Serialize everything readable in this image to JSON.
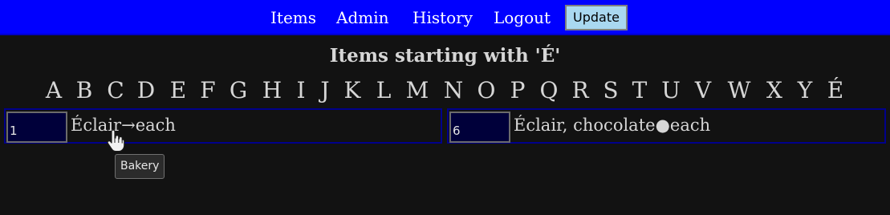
{
  "nav": {
    "links": [
      "Items",
      "Admin",
      "History",
      "Logout"
    ],
    "update_label": "Update"
  },
  "heading": "Items starting with 'É'",
  "letters": [
    "A",
    "B",
    "C",
    "D",
    "E",
    "F",
    "G",
    "H",
    "I",
    "J",
    "K",
    "L",
    "M",
    "N",
    "O",
    "P",
    "Q",
    "R",
    "S",
    "T",
    "U",
    "V",
    "W",
    "X",
    "Y",
    "É"
  ],
  "items": [
    {
      "quantity": "1",
      "name": "Éclair",
      "separator": "→",
      "unit": "each"
    },
    {
      "quantity": "6",
      "name": "Éclair, chocolate",
      "separator": "●",
      "unit": "each"
    }
  ],
  "tooltip": "Bakery",
  "icons": {
    "cursor": "hand-pointer-icon"
  },
  "colors": {
    "nav_background": "#0000ff",
    "page_background": "#121212",
    "update_button": "#a9d8f0",
    "item_border": "#00008b",
    "quantity_background": "#00003a"
  }
}
